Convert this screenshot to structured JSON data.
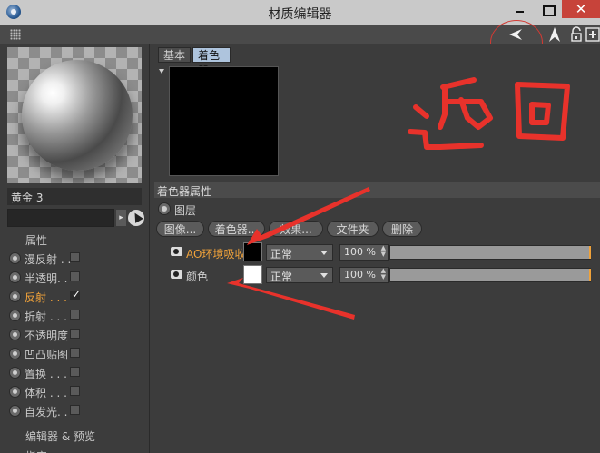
{
  "window": {
    "title": "材质编辑器",
    "close_label": "✕"
  },
  "preview": {
    "material_name": "黄金 3"
  },
  "attributes": {
    "header": "属性",
    "channels": [
      {
        "label": "漫反射 . .",
        "checked": false,
        "active": false
      },
      {
        "label": "半透明. .",
        "checked": false,
        "active": false
      },
      {
        "label": "反射 . . .",
        "checked": true,
        "active": true
      },
      {
        "label": "折射 . . .",
        "checked": false,
        "active": false
      },
      {
        "label": "不透明度",
        "checked": false,
        "active": false
      },
      {
        "label": "凹凸贴图",
        "checked": false,
        "active": false
      },
      {
        "label": "置换 . . .",
        "checked": false,
        "active": false
      },
      {
        "label": "体积 . . .",
        "checked": false,
        "active": false
      },
      {
        "label": "自发光. .",
        "checked": false,
        "active": false
      }
    ],
    "editor_preview": "编辑器 & 预览",
    "designate": "指定"
  },
  "tabs": [
    {
      "label": "基本",
      "active": false
    },
    {
      "label": "着色器",
      "active": true
    }
  ],
  "shader": {
    "section_title": "着色器属性",
    "layer_label": "图层",
    "buttons": [
      "图像...",
      "着色器...",
      "效果...",
      "文件夹",
      "删除"
    ],
    "layers": [
      {
        "name": "AO环境吸收",
        "swatch": "#000000",
        "mode": "正常",
        "percent": "100 %",
        "percent_value": 100,
        "highlighted": true
      },
      {
        "name": "颜色",
        "swatch": "#ffffff",
        "mode": "正常",
        "percent": "100 %",
        "percent_value": 100,
        "highlighted": false
      }
    ]
  },
  "annotations": {
    "handwritten_text": "返回",
    "color": "#e8322b"
  }
}
